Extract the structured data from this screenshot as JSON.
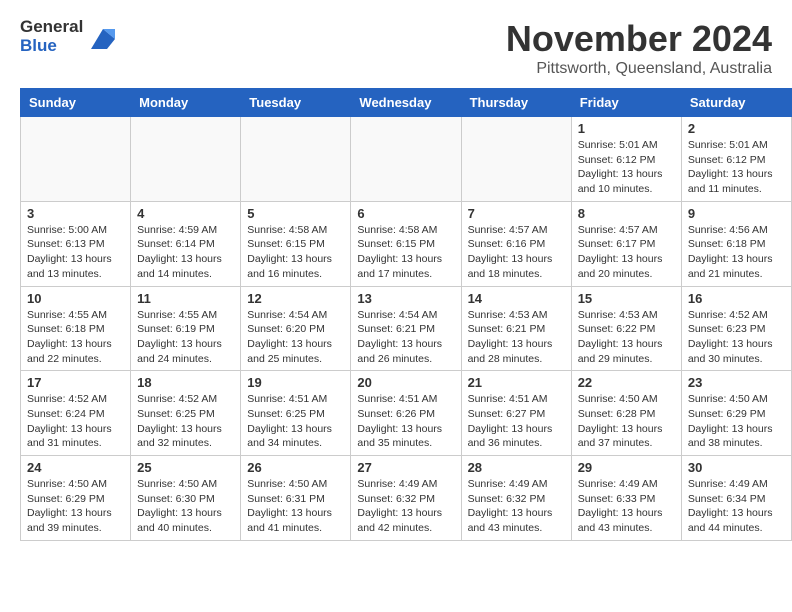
{
  "header": {
    "logo_line1": "General",
    "logo_line2": "Blue",
    "month_title": "November 2024",
    "location": "Pittsworth, Queensland, Australia"
  },
  "days_of_week": [
    "Sunday",
    "Monday",
    "Tuesday",
    "Wednesday",
    "Thursday",
    "Friday",
    "Saturday"
  ],
  "weeks": [
    [
      {
        "day": "",
        "info": "",
        "empty": true
      },
      {
        "day": "",
        "info": "",
        "empty": true
      },
      {
        "day": "",
        "info": "",
        "empty": true
      },
      {
        "day": "",
        "info": "",
        "empty": true
      },
      {
        "day": "",
        "info": "",
        "empty": true
      },
      {
        "day": "1",
        "info": "Sunrise: 5:01 AM\nSunset: 6:12 PM\nDaylight: 13 hours and 10 minutes."
      },
      {
        "day": "2",
        "info": "Sunrise: 5:01 AM\nSunset: 6:12 PM\nDaylight: 13 hours and 11 minutes."
      }
    ],
    [
      {
        "day": "3",
        "info": "Sunrise: 5:00 AM\nSunset: 6:13 PM\nDaylight: 13 hours and 13 minutes."
      },
      {
        "day": "4",
        "info": "Sunrise: 4:59 AM\nSunset: 6:14 PM\nDaylight: 13 hours and 14 minutes."
      },
      {
        "day": "5",
        "info": "Sunrise: 4:58 AM\nSunset: 6:15 PM\nDaylight: 13 hours and 16 minutes."
      },
      {
        "day": "6",
        "info": "Sunrise: 4:58 AM\nSunset: 6:15 PM\nDaylight: 13 hours and 17 minutes."
      },
      {
        "day": "7",
        "info": "Sunrise: 4:57 AM\nSunset: 6:16 PM\nDaylight: 13 hours and 18 minutes."
      },
      {
        "day": "8",
        "info": "Sunrise: 4:57 AM\nSunset: 6:17 PM\nDaylight: 13 hours and 20 minutes."
      },
      {
        "day": "9",
        "info": "Sunrise: 4:56 AM\nSunset: 6:18 PM\nDaylight: 13 hours and 21 minutes."
      }
    ],
    [
      {
        "day": "10",
        "info": "Sunrise: 4:55 AM\nSunset: 6:18 PM\nDaylight: 13 hours and 22 minutes."
      },
      {
        "day": "11",
        "info": "Sunrise: 4:55 AM\nSunset: 6:19 PM\nDaylight: 13 hours and 24 minutes."
      },
      {
        "day": "12",
        "info": "Sunrise: 4:54 AM\nSunset: 6:20 PM\nDaylight: 13 hours and 25 minutes."
      },
      {
        "day": "13",
        "info": "Sunrise: 4:54 AM\nSunset: 6:21 PM\nDaylight: 13 hours and 26 minutes."
      },
      {
        "day": "14",
        "info": "Sunrise: 4:53 AM\nSunset: 6:21 PM\nDaylight: 13 hours and 28 minutes."
      },
      {
        "day": "15",
        "info": "Sunrise: 4:53 AM\nSunset: 6:22 PM\nDaylight: 13 hours and 29 minutes."
      },
      {
        "day": "16",
        "info": "Sunrise: 4:52 AM\nSunset: 6:23 PM\nDaylight: 13 hours and 30 minutes."
      }
    ],
    [
      {
        "day": "17",
        "info": "Sunrise: 4:52 AM\nSunset: 6:24 PM\nDaylight: 13 hours and 31 minutes."
      },
      {
        "day": "18",
        "info": "Sunrise: 4:52 AM\nSunset: 6:25 PM\nDaylight: 13 hours and 32 minutes."
      },
      {
        "day": "19",
        "info": "Sunrise: 4:51 AM\nSunset: 6:25 PM\nDaylight: 13 hours and 34 minutes."
      },
      {
        "day": "20",
        "info": "Sunrise: 4:51 AM\nSunset: 6:26 PM\nDaylight: 13 hours and 35 minutes."
      },
      {
        "day": "21",
        "info": "Sunrise: 4:51 AM\nSunset: 6:27 PM\nDaylight: 13 hours and 36 minutes."
      },
      {
        "day": "22",
        "info": "Sunrise: 4:50 AM\nSunset: 6:28 PM\nDaylight: 13 hours and 37 minutes."
      },
      {
        "day": "23",
        "info": "Sunrise: 4:50 AM\nSunset: 6:29 PM\nDaylight: 13 hours and 38 minutes."
      }
    ],
    [
      {
        "day": "24",
        "info": "Sunrise: 4:50 AM\nSunset: 6:29 PM\nDaylight: 13 hours and 39 minutes."
      },
      {
        "day": "25",
        "info": "Sunrise: 4:50 AM\nSunset: 6:30 PM\nDaylight: 13 hours and 40 minutes."
      },
      {
        "day": "26",
        "info": "Sunrise: 4:50 AM\nSunset: 6:31 PM\nDaylight: 13 hours and 41 minutes."
      },
      {
        "day": "27",
        "info": "Sunrise: 4:49 AM\nSunset: 6:32 PM\nDaylight: 13 hours and 42 minutes."
      },
      {
        "day": "28",
        "info": "Sunrise: 4:49 AM\nSunset: 6:32 PM\nDaylight: 13 hours and 43 minutes."
      },
      {
        "day": "29",
        "info": "Sunrise: 4:49 AM\nSunset: 6:33 PM\nDaylight: 13 hours and 43 minutes."
      },
      {
        "day": "30",
        "info": "Sunrise: 4:49 AM\nSunset: 6:34 PM\nDaylight: 13 hours and 44 minutes."
      }
    ]
  ]
}
